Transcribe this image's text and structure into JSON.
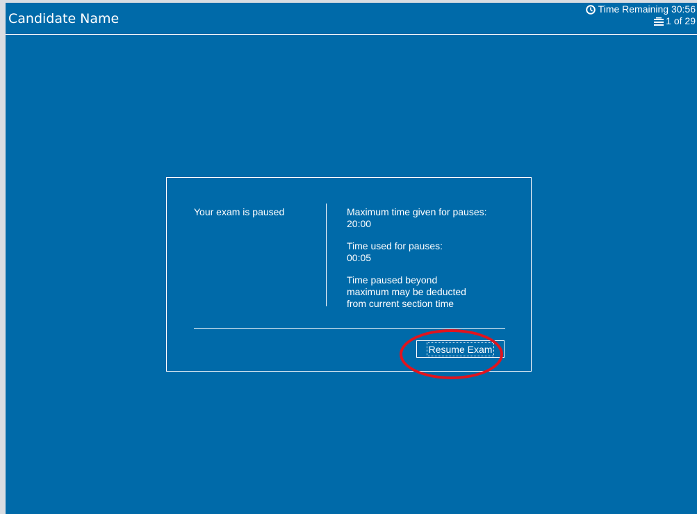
{
  "header": {
    "candidate_name": "Candidate Name",
    "time_remaining": "Time Remaining 30:56",
    "page_indicator": "1 of 29",
    "clock_icon": "clock-icon",
    "pages_icon": "pages-icon"
  },
  "pause_dialog": {
    "status": "Your exam is paused",
    "max_pause_label": "Maximum time given for pauses:",
    "max_pause_value": "20:00",
    "used_pause_label": "Time used for pauses:",
    "used_pause_value": "00:05",
    "note_line1": "Time paused beyond",
    "note_line2": "maximum may be deducted",
    "note_line3": "from current section time",
    "resume_label": "Resume Exam"
  },
  "colors": {
    "background": "#006aa9",
    "text": "#ffffff",
    "annotation": "#e0141e"
  }
}
